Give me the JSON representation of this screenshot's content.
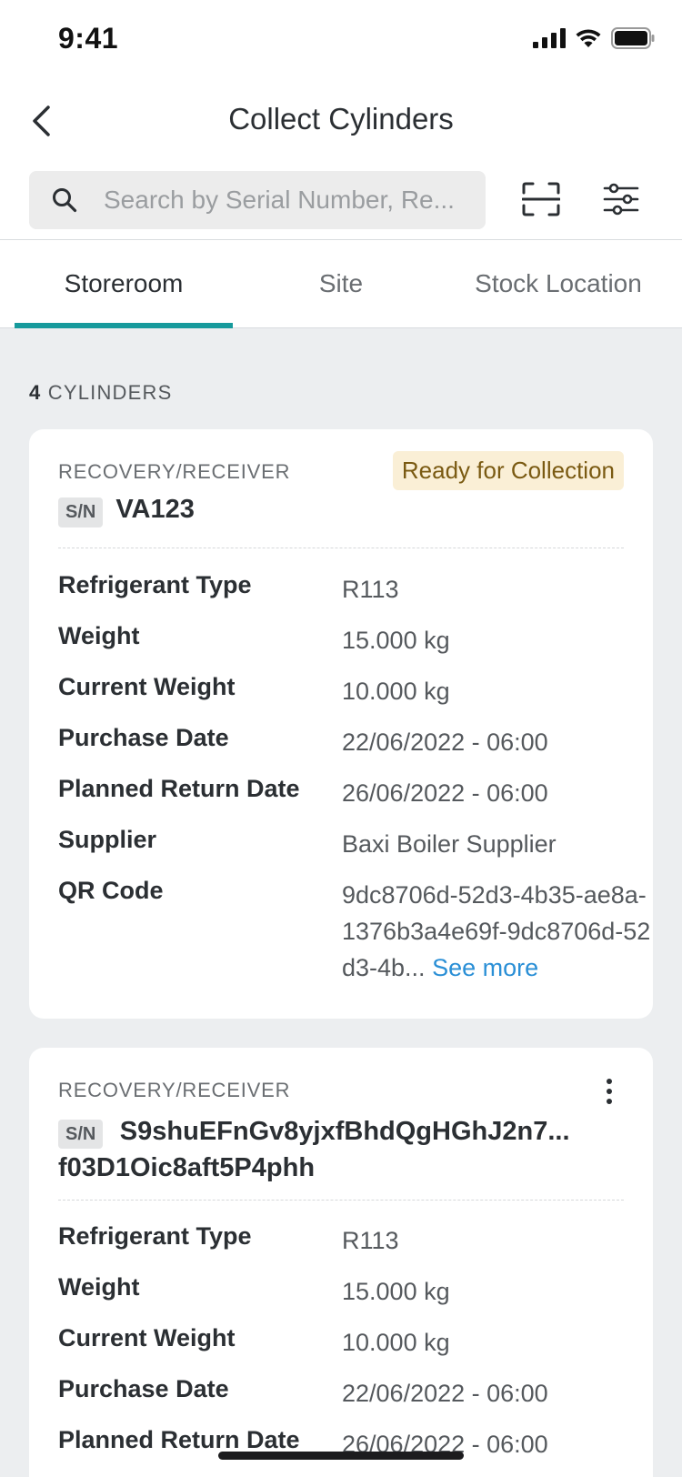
{
  "status_bar": {
    "time": "9:41"
  },
  "nav": {
    "title": "Collect Cylinders"
  },
  "search": {
    "placeholder": "Search by Serial Number, Re..."
  },
  "tabs": [
    {
      "label": "Storeroom",
      "active": true
    },
    {
      "label": "Site",
      "active": false
    },
    {
      "label": "Stock Location",
      "active": false
    }
  ],
  "list": {
    "count": "4",
    "count_label": "CYLINDERS"
  },
  "cards": [
    {
      "type": "RECOVERY/RECEIVER",
      "status": "Ready for Collection",
      "sn_label": "S/N",
      "sn": "VA123",
      "details": [
        {
          "label": "Refrigerant Type",
          "value": "R113"
        },
        {
          "label": "Weight",
          "value": "15.000 kg"
        },
        {
          "label": "Current Weight",
          "value": "10.000 kg"
        },
        {
          "label": "Purchase Date",
          "value": "22/06/2022 - 06:00"
        },
        {
          "label": "Planned Return Date",
          "value": "26/06/2022 - 06:00"
        },
        {
          "label": "Supplier",
          "value": "Baxi Boiler Supplier"
        },
        {
          "label": "QR Code",
          "value": "9dc8706d-52d3-4b35-ae8a-1376b3a4e69f-9dc8706d-52d3-4b...",
          "link": "See more"
        }
      ]
    },
    {
      "type": "RECOVERY/RECEIVER",
      "sn_label": "S/N",
      "sn": "S9shuEFnGv8yjxfBhdQgHGhJ2n7... f03D1Oic8aft5P4phh",
      "details": [
        {
          "label": "Refrigerant Type",
          "value": "R113"
        },
        {
          "label": "Weight",
          "value": "15.000 kg"
        },
        {
          "label": "Current Weight",
          "value": "10.000 kg"
        },
        {
          "label": "Purchase Date",
          "value": "22/06/2022 - 06:00"
        },
        {
          "label": "Planned Return Date",
          "value": "26/06/2022 - 06:00"
        }
      ]
    }
  ],
  "colors": {
    "accent": "#169a9c",
    "link": "#2a8fd6",
    "badge_bg": "#faefd6",
    "badge_text": "#7a5a12",
    "background": "#eceef0"
  },
  "icons": {
    "back": "chevron-left-icon",
    "search": "search-icon",
    "scan": "scan-frame-icon",
    "filter": "sliders-icon",
    "more": "more-vertical-icon"
  }
}
